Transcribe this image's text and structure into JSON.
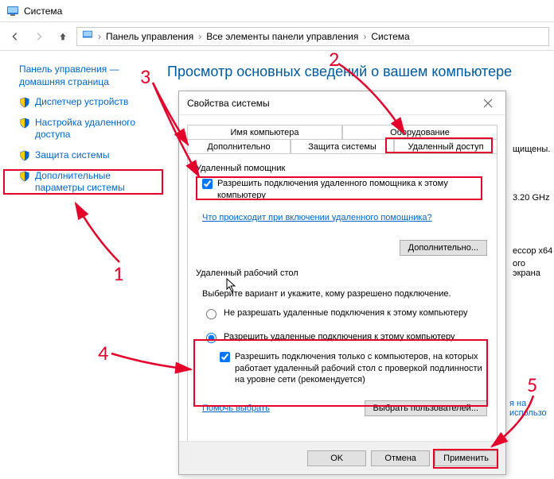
{
  "window": {
    "title": "Система"
  },
  "breadcrumb": {
    "a": "Панель управления",
    "b": "Все элементы панели управления",
    "c": "Система"
  },
  "sidebar": {
    "home": "Панель управления — домашняя страница",
    "items": [
      "Диспетчер устройств",
      "Настройка удаленного доступа",
      "Защита системы",
      "Дополнительные параметры системы"
    ]
  },
  "main": {
    "heading": "Просмотр основных сведений о вашем компьютере"
  },
  "bg": {
    "protected": "щищены.",
    "ghz": "3.20 GHz",
    "arch": "ессор x64",
    "screen": "ого экрана",
    "use": "я на использо"
  },
  "dialog": {
    "title": "Свойства системы",
    "tabs": {
      "computer_name": "Имя компьютера",
      "hardware": "Оборудование",
      "advanced": "Дополнительно",
      "sys_protect": "Защита системы",
      "remote": "Удаленный доступ"
    },
    "ra": {
      "group": "Удаленный помощник",
      "allow": "Разрешить подключения удаленного помощника к этому компьютеру",
      "whatlink": "Что происходит при включении удаленного помощника?",
      "adv_btn": "Дополнительно..."
    },
    "rd": {
      "group": "Удаленный рабочий стол",
      "prompt": "Выберите вариант и укажите, кому разрешено подключение.",
      "opt_deny": "Не разрешать удаленные подключения к этому компьютеру",
      "opt_allow": "Разрешить удаленные подключения к этому компьютеру",
      "nla": "Разрешить подключения только с компьютеров, на которых работает удаленный рабочий стол с проверкой подлинности на уровне сети (рекомендуется)",
      "help": "Помочь выбрать",
      "select_users": "Выбрать пользователей..."
    },
    "footer": {
      "ok": "OK",
      "cancel": "Отмена",
      "apply": "Применить"
    }
  },
  "ann": {
    "n1": "1",
    "n2": "2",
    "n3": "3",
    "n4": "4",
    "n5": "5"
  }
}
